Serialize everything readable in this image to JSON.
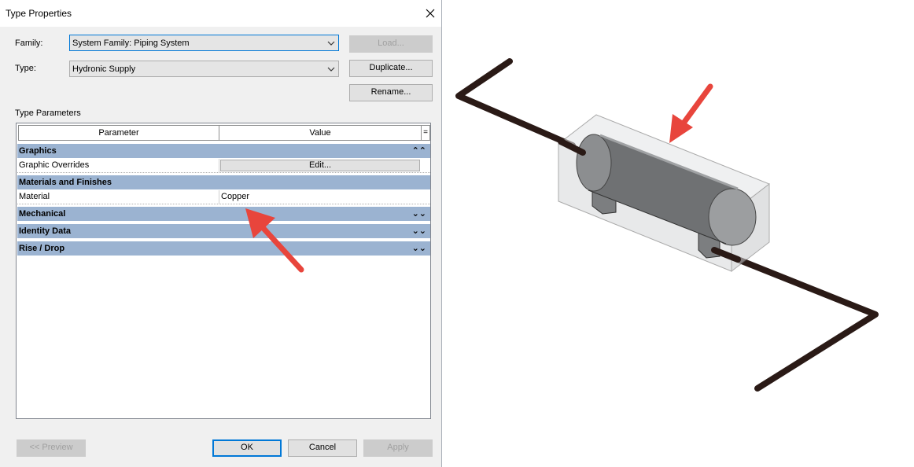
{
  "dialog": {
    "title": "Type Properties",
    "family_label": "Family:",
    "family_value": "System Family: Piping System",
    "type_label": "Type:",
    "type_value": "Hydronic Supply",
    "load_button": "Load...",
    "duplicate_button": "Duplicate...",
    "rename_button": "Rename...",
    "section_label": "Type Parameters",
    "grid": {
      "col_parameter": "Parameter",
      "col_value": "Value",
      "col_toggle": "=",
      "groups": [
        {
          "name": "Graphics",
          "toggle": "⌃⌃"
        },
        {
          "name": "Materials and Finishes",
          "toggle": ""
        },
        {
          "name": "Mechanical",
          "toggle": "⌄⌄"
        },
        {
          "name": "Identity Data",
          "toggle": "⌄⌄"
        },
        {
          "name": "Rise / Drop",
          "toggle": "⌄⌄"
        }
      ],
      "params": [
        {
          "name": "Graphic Overrides",
          "value": "Edit..."
        },
        {
          "name": "Material",
          "value": "Copper"
        }
      ]
    },
    "preview_button": "<< Preview",
    "ok_button": "OK",
    "cancel_button": "Cancel",
    "apply_button": "Apply"
  },
  "colors": {
    "group_header": "#9bb3d1",
    "pipe": "#2a1a16",
    "arrow": "#e8453c",
    "focus": "#0078d7"
  }
}
